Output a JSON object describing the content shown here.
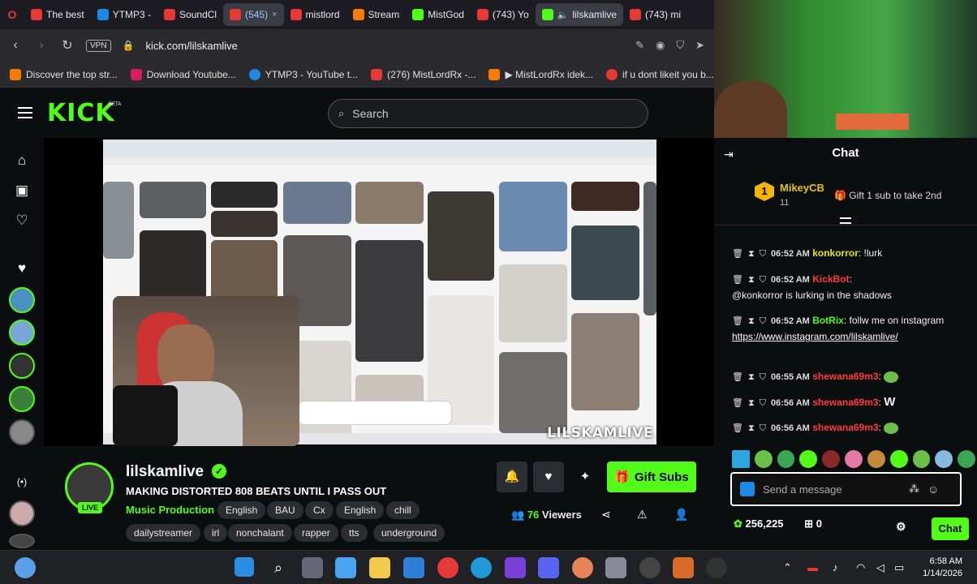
{
  "browser": {
    "tabs": [
      {
        "label": "The best",
        "color": "#e53935"
      },
      {
        "label": "YTMP3 -",
        "color": "#1e88e5"
      },
      {
        "label": "SoundCl",
        "color": "#e53935"
      },
      {
        "label": "(545)",
        "color": "#e53935",
        "active": true
      },
      {
        "label": "mistlord",
        "color": "#e53935"
      },
      {
        "label": "Stream",
        "color": "#f57c00"
      },
      {
        "label": "MistGod",
        "color": "#53fc18"
      },
      {
        "label": "(743) Yo",
        "color": "#e53935"
      },
      {
        "label": "lilskamlive",
        "color": "#53fc18",
        "active": true
      },
      {
        "label": "(743) mi",
        "color": "#e53935"
      }
    ],
    "vpn_label": "VPN",
    "url": "kick.com/lilskamlive",
    "bookmarks": [
      {
        "label": "Discover the top str...",
        "color": "#f57c00"
      },
      {
        "label": "Download Youtube...",
        "color": "#d81b60"
      },
      {
        "label": "YTMP3 - YouTube t...",
        "color": "#1e88e5"
      },
      {
        "label": "(276) MistLordRx -...",
        "color": "#e53935"
      },
      {
        "label": "▶ MistLordRx idek...",
        "color": "#f57c00"
      },
      {
        "label": "if u dont likeit you b...",
        "color": "#e53935"
      }
    ]
  },
  "kick": {
    "logo": "KICK",
    "beta": "BETA",
    "search_placeholder": "Search"
  },
  "video": {
    "overlay_name": "LILSKAMLIVE"
  },
  "stream": {
    "channel": "lilskamlive",
    "live_badge": "LIVE",
    "title": "MAKING DISTORTED 808 BEATS UNTIL I PASS OUT",
    "category": "Music Production",
    "tags_row1": [
      "English",
      "BAU",
      "Cx",
      "English",
      "chill"
    ],
    "tags_row2": [
      "dailystreamer",
      "irl",
      "nonchalant",
      "rapper",
      "tts",
      "underground"
    ],
    "gift_label": "Gift Subs",
    "viewers_count": "76",
    "viewers_label": "Viewers"
  },
  "chat": {
    "title": "Chat",
    "pinned": {
      "rank": "1",
      "user": "MikeyCB",
      "count": "11",
      "gift_text": "Gift 1 sub to take 2nd"
    },
    "messages": [
      {
        "time": "06:52 AM",
        "user": "konkorror",
        "text": "!lurk",
        "color": "yellow"
      },
      {
        "time": "06:52 AM",
        "user": "KickBot",
        "text": "@konkorror is lurking in the shadows",
        "color": "red"
      },
      {
        "time": "06:52 AM",
        "user": "BotRix",
        "text": "follw me on instagram",
        "link": "https://www.instagram.com/lilskamlive/",
        "color": "green"
      },
      {
        "time": "06:55 AM",
        "user": "shewana69m3",
        "text": "",
        "color": "red"
      },
      {
        "time": "06:56 AM",
        "user": "shewana69m3",
        "text": "W",
        "color": "red"
      },
      {
        "time": "06:56 AM",
        "user": "shewana69m3",
        "text": "",
        "color": "red"
      }
    ],
    "input_placeholder": "Send a message",
    "points": "256,225",
    "gifts": "0",
    "send_label": "Chat"
  },
  "taskbar": {
    "time": "6:58 AM",
    "date": "1/14/2026"
  }
}
